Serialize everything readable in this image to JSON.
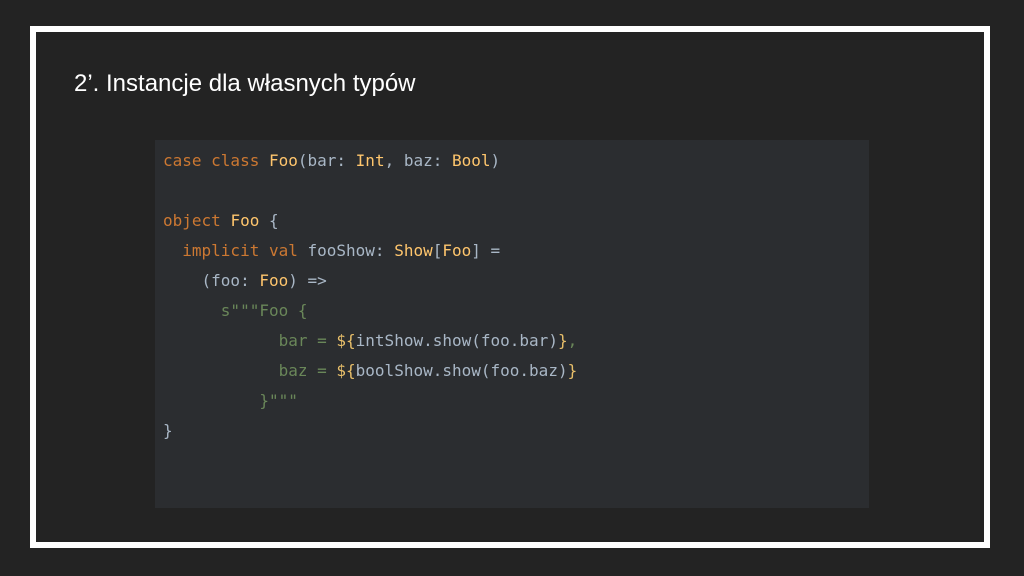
{
  "slide": {
    "title": "2’. Instancje dla własnych typów"
  },
  "code": {
    "lines": [
      [
        [
          "kw",
          "case class "
        ],
        [
          "ty",
          "Foo"
        ],
        [
          "pl",
          "(bar: "
        ],
        [
          "ty",
          "Int"
        ],
        [
          "pl",
          ", baz: "
        ],
        [
          "ty",
          "Bool"
        ],
        [
          "pl",
          ")"
        ]
      ],
      [],
      [
        [
          "kw",
          "object "
        ],
        [
          "ty",
          "Foo"
        ],
        [
          "pl",
          " {"
        ]
      ],
      [
        [
          "pl",
          "  "
        ],
        [
          "kw",
          "implicit val "
        ],
        [
          "pl",
          "fooShow: "
        ],
        [
          "ty",
          "Show"
        ],
        [
          "pl",
          "["
        ],
        [
          "ty",
          "Foo"
        ],
        [
          "pl",
          "] ="
        ]
      ],
      [
        [
          "pl",
          "    (foo: "
        ],
        [
          "ty",
          "Foo"
        ],
        [
          "pl",
          ") =>"
        ]
      ],
      [
        [
          "st",
          "      s\"\"\"Foo {"
        ]
      ],
      [
        [
          "st",
          "            bar = "
        ],
        [
          "br",
          "${"
        ],
        [
          "pl",
          "intShow.show(foo.bar)"
        ],
        [
          "br",
          "}"
        ],
        [
          "st",
          ","
        ]
      ],
      [
        [
          "st",
          "            baz = "
        ],
        [
          "br",
          "${"
        ],
        [
          "pl",
          "boolShow.show(foo.baz)"
        ],
        [
          "br",
          "}"
        ]
      ],
      [
        [
          "st",
          "          }\"\"\""
        ]
      ],
      [
        [
          "pl",
          "}"
        ]
      ]
    ]
  }
}
